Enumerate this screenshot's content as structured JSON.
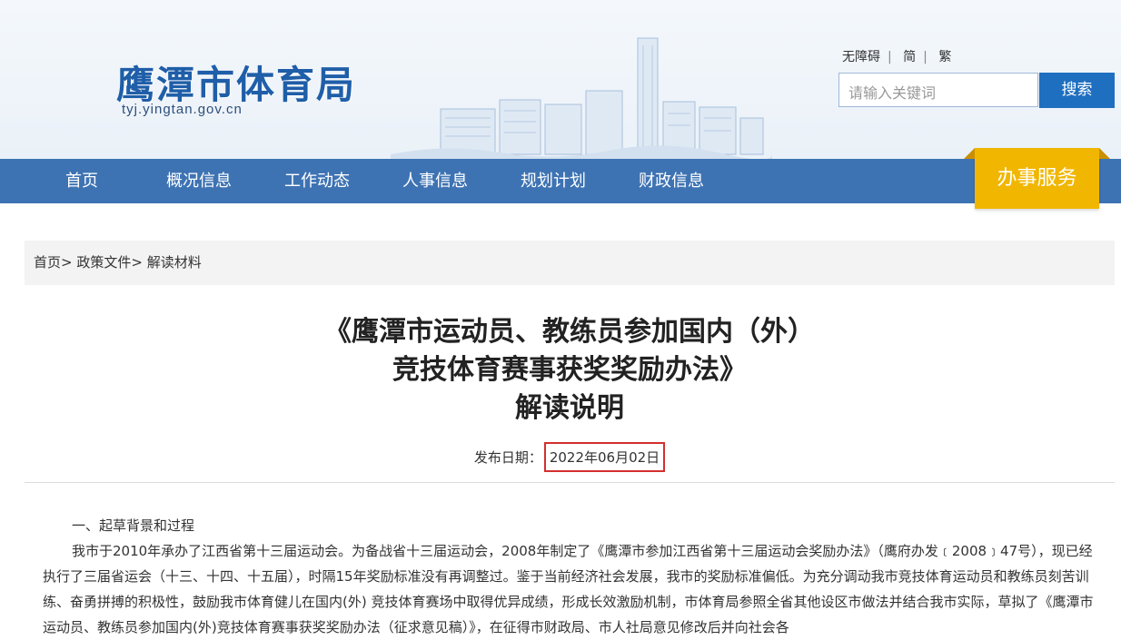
{
  "header": {
    "site_name": "鹰潭市体育局",
    "domain": "tyj.yingtan.gov.cn",
    "top_links": [
      "无障碍",
      "简",
      "繁"
    ],
    "search": {
      "placeholder": "请输入关键词",
      "button": "搜索"
    }
  },
  "nav": {
    "items": [
      "首页",
      "概况信息",
      "工作动态",
      "人事信息",
      "规划计划",
      "财政信息"
    ],
    "service": "办事服务"
  },
  "breadcrumb": [
    "首页",
    "政策文件",
    "解读材料"
  ],
  "article": {
    "title_lines": [
      "《鹰潭市运动员、教练员参加国内（外）",
      "竞技体育赛事获奖奖励办法》",
      "解读说明"
    ],
    "pub_label": "发布日期：",
    "pub_date": "2022年06月02日",
    "section_heading": "一、起草背景和过程",
    "paragraph": "我市于2010年承办了江西省第十三届运动会。为备战省十三届运动会，2008年制定了《鹰潭市参加江西省第十三届运动会奖励办法》（鹰府办发﹝2008﹞47号），现已经执行了三届省运会（十三、十四、十五届），时隔15年奖励标准没有再调整过。鉴于当前经济社会发展，我市的奖励标准偏低。为充分调动我市竞技体育运动员和教练员刻苦训练、奋勇拼搏的积极性，鼓励我市体育健儿在国内(外) 竞技体育赛场中取得优异成绩，形成长效激励机制，市体育局参照全省其他设区市做法并结合我市实际，草拟了《鹰潭市运动员、教练员参加国内(外)竞技体育赛事获奖奖励办法（征求意见稿）》，在征得市财政局、市人社局意见修改后并向社会各"
  },
  "colors": {
    "nav": "#3e73b3",
    "service": "#f1b600",
    "search": "#1f6fc0",
    "highlight": "#d32f2f"
  }
}
